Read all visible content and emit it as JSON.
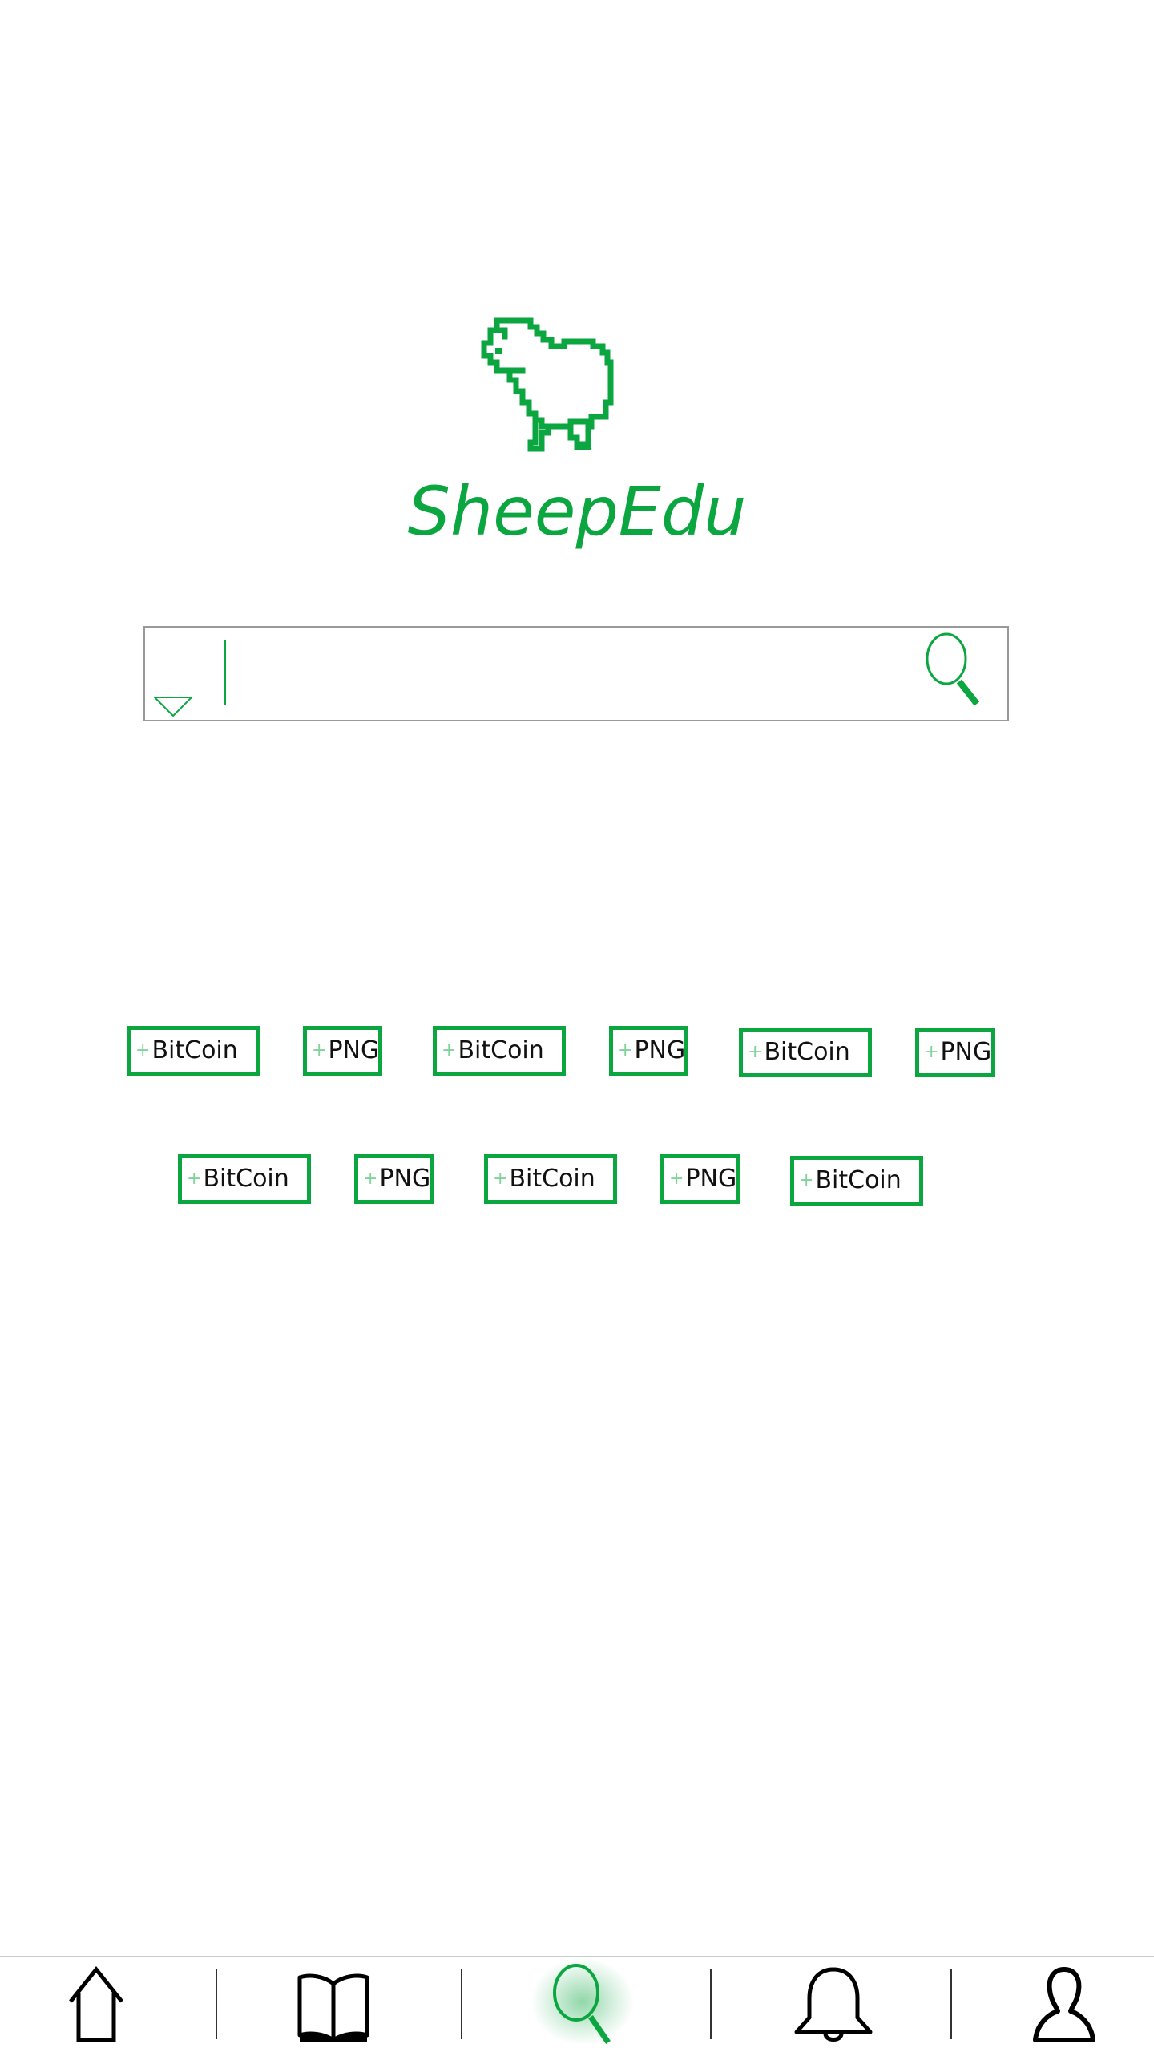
{
  "brand": {
    "name": "SheepEdu",
    "logo_icon": "sheep-icon",
    "accent_color": "#0ba640"
  },
  "search": {
    "value": "",
    "placeholder": "",
    "filter_icon": "triangle-down-icon",
    "submit_icon": "search-icon"
  },
  "tags": [
    {
      "label": "BitCoin"
    },
    {
      "label": "PNG"
    },
    {
      "label": "BitCoin"
    },
    {
      "label": "PNG"
    },
    {
      "label": "BitCoin"
    },
    {
      "label": "PNG"
    },
    {
      "label": "BitCoin"
    },
    {
      "label": "PNG"
    },
    {
      "label": "BitCoin"
    },
    {
      "label": "PNG"
    },
    {
      "label": "BitCoin"
    }
  ],
  "tab_bar": {
    "active": "search",
    "items": [
      {
        "id": "home",
        "icon": "home-icon"
      },
      {
        "id": "library",
        "icon": "book-icon"
      },
      {
        "id": "search",
        "icon": "search-icon"
      },
      {
        "id": "notifications",
        "icon": "bell-icon"
      },
      {
        "id": "profile",
        "icon": "user-icon"
      }
    ]
  }
}
